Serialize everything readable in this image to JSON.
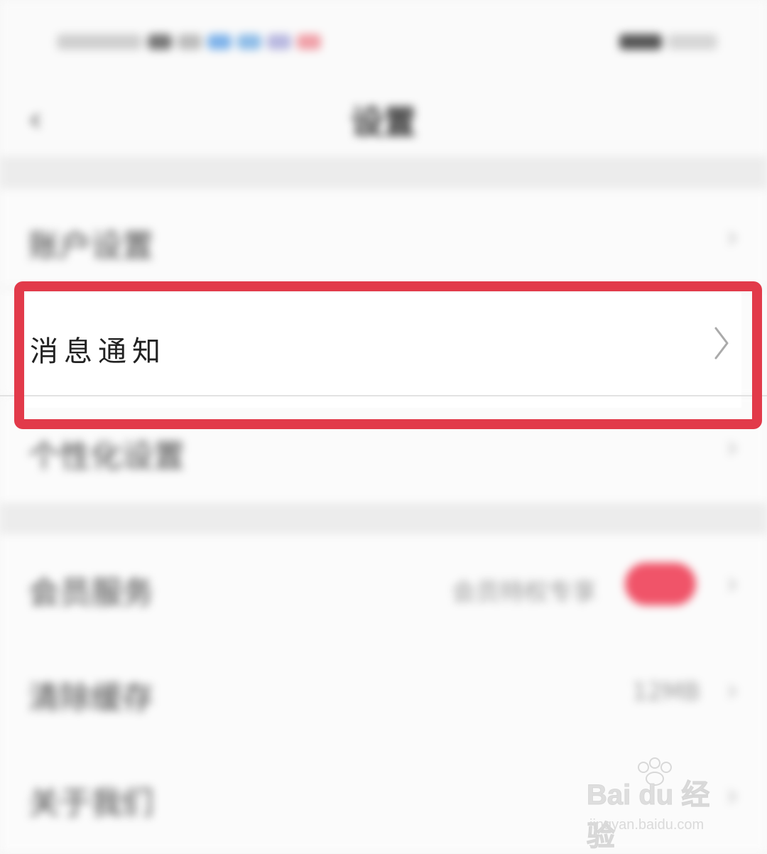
{
  "header": {
    "back_icon": "chevron-left-icon",
    "title": "设置"
  },
  "rows": [
    {
      "label": "账户设置"
    },
    {
      "label": "消息通知",
      "highlighted": true
    },
    {
      "label": "个性化设置"
    },
    {
      "label": "会员服务",
      "value": "会员特权专享",
      "badge_color": "#f05469"
    },
    {
      "label": "清除缓存",
      "value": "12MB"
    },
    {
      "label": "关于我们"
    }
  ],
  "highlight": {
    "color": "#e23a4a"
  },
  "watermark": {
    "brand": "Bai du 经验",
    "url": "jingyan.baidu.com"
  }
}
